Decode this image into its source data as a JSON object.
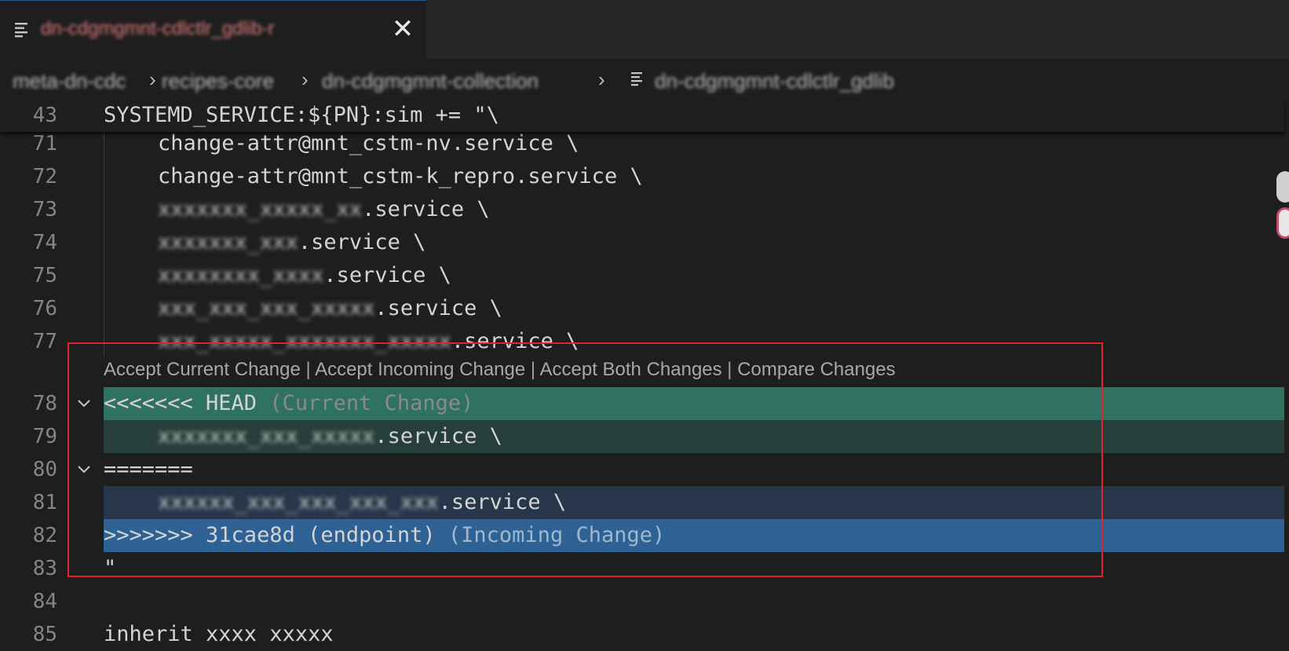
{
  "tab": {
    "label": "dn-cdgmgmnt-cdlctlr_gdlib-r",
    "close_glyph": "✕",
    "icon": "file-lines-icon"
  },
  "breadcrumb": {
    "items": [
      "meta-dn-cdc",
      "recipes-core",
      "dn-cdgmgmnt-collection",
      "dn-cdgmgmnt-cdlctlr_gdlib"
    ],
    "separator": "›"
  },
  "editor": {
    "sticky_line": {
      "number": "43",
      "text": "SYSTEMD_SERVICE:${PN}:sim += \"\\"
    },
    "lines": [
      {
        "number": "71",
        "text": "change-attr@mnt_cstm-nv.service \\",
        "obscured": ""
      },
      {
        "number": "72",
        "text": "change-attr@mnt_cstm-k_repro.service \\",
        "obscured": ""
      },
      {
        "number": "73",
        "obscured": "xxxxxxx_xxxxx_xx",
        "text": ".service \\"
      },
      {
        "number": "74",
        "obscured": "xxxxxxx_xxx",
        "text": ".service \\"
      },
      {
        "number": "75",
        "obscured": "xxxxxxxx_xxxx",
        "text": ".service \\"
      },
      {
        "number": "76",
        "obscured": "xxx_xxx_xxx_xxxxx",
        "text": ".service \\"
      },
      {
        "number": "77",
        "obscured": "xxx_xxxxx_xxxxxxx_xxxxx",
        "text": ".service \\"
      }
    ],
    "codelens": [
      "Accept Current Change",
      "Accept Incoming Change",
      "Accept Both Changes",
      "Compare Changes"
    ],
    "codelens_separator": " | ",
    "conflict": {
      "head_line": {
        "number": "78",
        "marker": "<<<<<<< HEAD",
        "hint": "(Current Change)"
      },
      "current_line": {
        "number": "79",
        "obscured": "xxxxxxx_xxx_xxxxx",
        "text": ".service \\"
      },
      "divider_line": {
        "number": "80",
        "marker": "======="
      },
      "incoming_line": {
        "number": "81",
        "obscured": "xxxxxx_xxx_xxx_xxx_xxx",
        "text": ".service \\"
      },
      "incoming_head": {
        "number": "82",
        "marker": ">>>>>>> 31cae8d (endpoint)",
        "hint": "(Incoming Change)"
      },
      "closing_line": {
        "number": "83",
        "text": "\""
      }
    },
    "after_lines": [
      {
        "number": "84",
        "text": ""
      },
      {
        "number": "85",
        "text": "inherit xxxx xxxxx"
      }
    ]
  },
  "colors": {
    "current_head_bg": "#2f7262",
    "current_bg": "#273f3a",
    "incoming_bg": "#27364a",
    "incoming_head_bg": "#2e6294",
    "annotation_box": "#e0242d"
  }
}
